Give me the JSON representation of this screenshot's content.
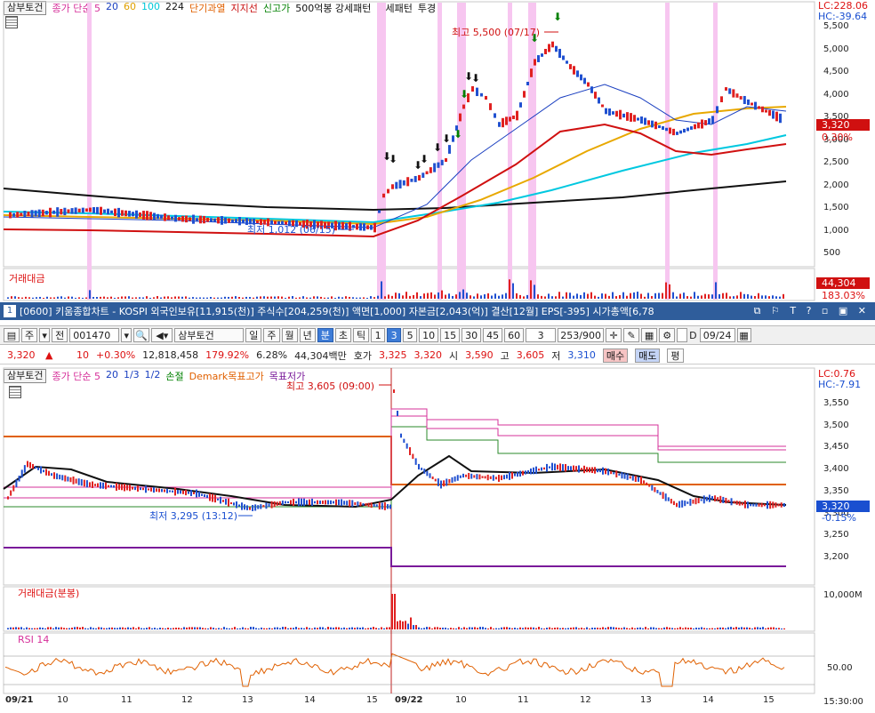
{
  "top_chart": {
    "name_button": "삼부토건",
    "legend": [
      {
        "text": "종가 단순 5",
        "color": "#d6309a"
      },
      {
        "text": "20",
        "color": "#1a3fc0"
      },
      {
        "text": "60",
        "color": "#e0a000"
      },
      {
        "text": "100",
        "color": "#00c8d8"
      },
      {
        "text": "224",
        "color": "#111111"
      },
      {
        "text": "단기과열",
        "color": "#e06000"
      },
      {
        "text": "지지선",
        "color": "#c81010"
      },
      {
        "text": "신고가",
        "color": "#008000"
      },
      {
        "text": "500억봉 강세패턴",
        "color": "#111111"
      },
      {
        "text": "약세패턴",
        "color": "#111111"
      },
      {
        "text": "투경",
        "color": "#111111"
      }
    ],
    "high_annotation": "최고 5,500 (07/17)",
    "low_annotation": "최저 1,012 (06/15)",
    "lc": "LC:228.06",
    "hc": "HC:-39.64",
    "y_ticks": [
      "5,500",
      "5,000",
      "4,500",
      "4,000",
      "3,500",
      "3,000",
      "2,500",
      "2,000",
      "1,500",
      "1,000",
      "500"
    ],
    "price_badge": "3,320",
    "pct_badge": "0.30%",
    "volume_label": "거래대금",
    "volume_badge": "44,304",
    "volume_pct": "183.03%"
  },
  "titlebar": {
    "number": "1",
    "text": "[0600] 키움종합차트 - KOSPI 외국인보유[11,915(천)] 주식수[204,259(천)] 액면[1,000] 자본금[2,043(억)] 결산[12월] EPS[-395] 시가총액[6,78"
  },
  "toolbar": {
    "type1": "주",
    "type2": "전",
    "code": "001470",
    "name": "삼부토건",
    "periods": [
      "일",
      "주",
      "월",
      "년",
      "분",
      "초",
      "틱"
    ],
    "active_period": "분",
    "intervals": [
      "1",
      "3",
      "5",
      "10",
      "15",
      "30",
      "45",
      "60"
    ],
    "active_interval": "3",
    "count_select": "3",
    "count": "253/900",
    "date": "09/24",
    "checkbox_label": "D"
  },
  "quote": {
    "price": "3,320",
    "change": "10",
    "change_pct": "+0.30%",
    "volume": "12,818,458",
    "vol_ratio": "179.92%",
    "turnover": "6.28%",
    "amount": "44,304백만",
    "ask_label": "호가",
    "ask": "3,325",
    "bid": "3,320",
    "open_label": "시",
    "open": "3,590",
    "high_label": "고",
    "high": "3,605",
    "low_label": "저",
    "low": "3,310",
    "buy": "매수",
    "sell": "매도",
    "eval": "평"
  },
  "bottom_chart": {
    "name_button": "삼부토건",
    "legend": [
      {
        "text": "종가 단순 5",
        "color": "#d6309a"
      },
      {
        "text": "20",
        "color": "#1a3fc0"
      },
      {
        "text": "1/3",
        "color": "#1a3fc0"
      },
      {
        "text": "1/2",
        "color": "#1a3fc0"
      },
      {
        "text": "손절",
        "color": "#008000"
      },
      {
        "text": "Demark목표고가",
        "color": "#e06000"
      },
      {
        "text": "목표저가",
        "color": "#7a1a9a"
      }
    ],
    "high_annotation": "최고 3,605 (09:00)",
    "low_annotation": "최저 3,295 (13:12)",
    "lc": "LC:0.76",
    "hc": "HC:-7.91",
    "y_ticks": [
      "3,550",
      "3,500",
      "3,450",
      "3,400",
      "3,350",
      "3,300",
      "3,250",
      "3,200"
    ],
    "price_badge": "3,320",
    "pct_badge": "-0.15%",
    "volume_label": "거래대금(분봉)",
    "volume_tick": "10,000M",
    "rsi_label": "RSI 14",
    "rsi_tick": "50.00",
    "x_labels": [
      "09/21",
      "10",
      "11",
      "12",
      "13",
      "14",
      "15",
      "09/22",
      "10",
      "11",
      "12",
      "13",
      "14",
      "15"
    ],
    "time": "15:30:00"
  }
}
